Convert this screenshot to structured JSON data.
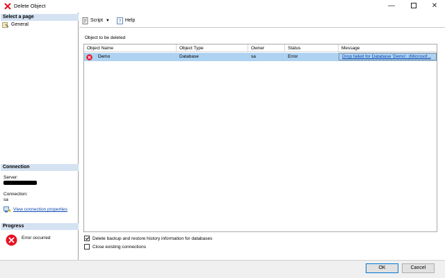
{
  "window": {
    "title": "Delete Object",
    "minimize_glyph": "—",
    "close_glyph": "✕"
  },
  "left": {
    "select_page_header": "Select a page",
    "pages": [
      {
        "label": "General",
        "icon": "page-wrench-icon"
      }
    ],
    "connection_header": "Connection",
    "server_label": "Server:",
    "connection_label": "Connection:",
    "connection_value": "sa",
    "view_connection_link": "View connection properties",
    "progress_header": "Progress",
    "progress_status": "Error occurred"
  },
  "toolbar": {
    "script_label": "Script",
    "help_label": "Help"
  },
  "main": {
    "object_label": "Object to be deleted",
    "columns": [
      "Object Name",
      "Object Type",
      "Owner",
      "Status",
      "Message"
    ],
    "rows": [
      {
        "name": "Demo",
        "type": "Database",
        "owner": "sa",
        "status": "Error",
        "message": "Drop failed for Database 'Demo'. (Microsof..."
      }
    ]
  },
  "options": {
    "delete_backup_label": "Delete backup and restore history information for databases",
    "delete_backup_checked": true,
    "close_connections_label": "Close existing connections",
    "close_connections_checked": false
  },
  "buttons": {
    "ok": "OK",
    "cancel": "Cancel"
  },
  "colors": {
    "header_bg": "#d4e2f2",
    "row_selected": "#aed2f2",
    "error_red": "#e81123",
    "link_blue": "#0645ad"
  }
}
